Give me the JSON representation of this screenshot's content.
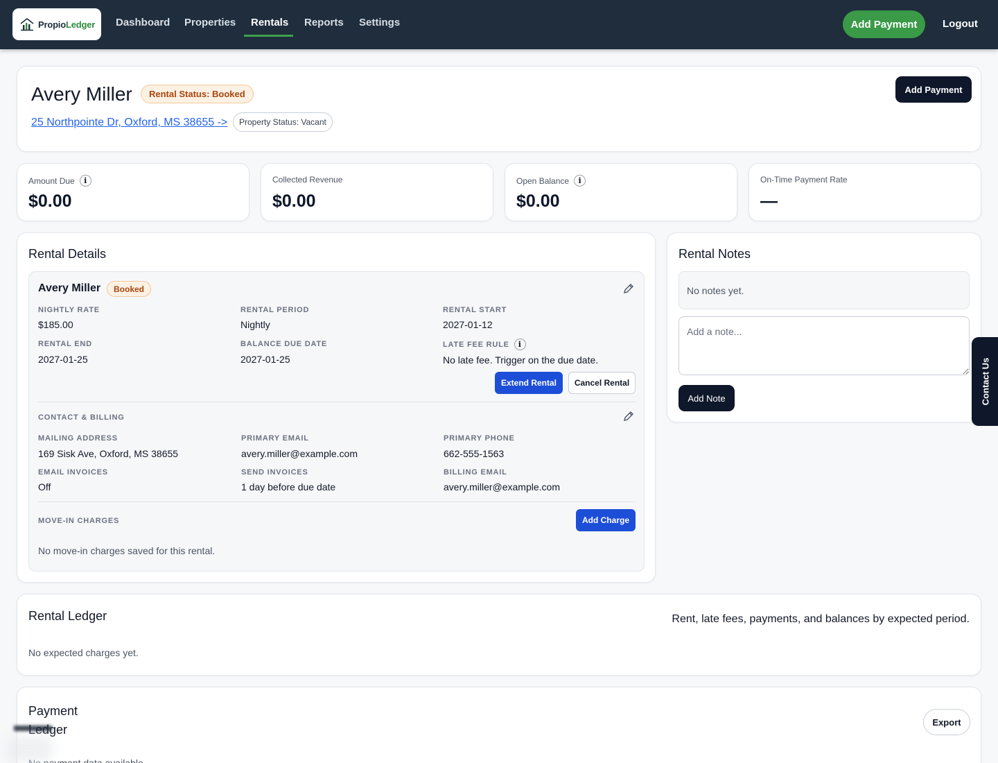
{
  "nav": {
    "brand_part1": "Propio",
    "brand_part2": "Ledger",
    "links": [
      "Dashboard",
      "Properties",
      "Rentals",
      "Reports",
      "Settings"
    ],
    "active": "Rentals",
    "add_payment": "Add Payment",
    "logout": "Logout"
  },
  "header": {
    "tenant_name": "Avery Miller",
    "rental_status": "Rental Status: Booked",
    "address": "25 Northpointe Dr, Oxford, MS 38655 ->",
    "property_status": "Property Status: Vacant",
    "add_payment": "Add Payment"
  },
  "stats": [
    {
      "label": "Amount Due",
      "value": "$0.00",
      "info": true
    },
    {
      "label": "Collected Revenue",
      "value": "$0.00",
      "info": false
    },
    {
      "label": "Open Balance",
      "value": "$0.00",
      "info": true
    },
    {
      "label": "On-Time Payment Rate",
      "value": "—",
      "info": false
    }
  ],
  "info_glyph": "i",
  "details": {
    "title": "Rental Details",
    "name": "Avery Miller",
    "badge": "Booked",
    "fields": {
      "nightly_rate": {
        "label": "NIGHTLY RATE",
        "value": "$185.00"
      },
      "rental_period": {
        "label": "RENTAL PERIOD",
        "value": "Nightly"
      },
      "rental_start": {
        "label": "RENTAL START",
        "value": "2027-01-12"
      },
      "rental_end": {
        "label": "RENTAL END",
        "value": "2027-01-25"
      },
      "balance_due": {
        "label": "BALANCE DUE DATE",
        "value": "2027-01-25"
      },
      "late_fee": {
        "label": "LATE FEE RULE",
        "value": "No late fee. Trigger on the due date."
      }
    },
    "extend_rental": "Extend Rental",
    "cancel_rental": "Cancel Rental",
    "contact_title": "CONTACT & BILLING",
    "contact": {
      "mailing_address": {
        "label": "MAILING ADDRESS",
        "value": "169 Sisk Ave, Oxford, MS 38655"
      },
      "primary_email": {
        "label": "PRIMARY EMAIL",
        "value": "avery.miller@example.com"
      },
      "primary_phone": {
        "label": "PRIMARY PHONE",
        "value": "662-555-1563"
      },
      "email_invoices": {
        "label": "EMAIL INVOICES",
        "value": "Off"
      },
      "send_invoices": {
        "label": "SEND INVOICES",
        "value": "1 day before due date"
      },
      "billing_email": {
        "label": "BILLING EMAIL",
        "value": "avery.miller@example.com"
      }
    },
    "movein_title": "MOVE-IN CHARGES",
    "add_charge": "Add Charge",
    "movein_empty": "No move-in charges saved for this rental."
  },
  "notes": {
    "title": "Rental Notes",
    "empty": "No notes yet.",
    "placeholder": "Add a note...",
    "add_note": "Add Note"
  },
  "contact_tab": "Contact Us",
  "ledger": {
    "title": "Rental Ledger",
    "subtitle": "Rent, late fees, payments, and balances by expected period.",
    "empty": "No expected charges yet."
  },
  "payment_ledger": {
    "title_line1": "Payment",
    "title_line2": "Ledger",
    "export": "Export",
    "empty": "No payment data available."
  }
}
